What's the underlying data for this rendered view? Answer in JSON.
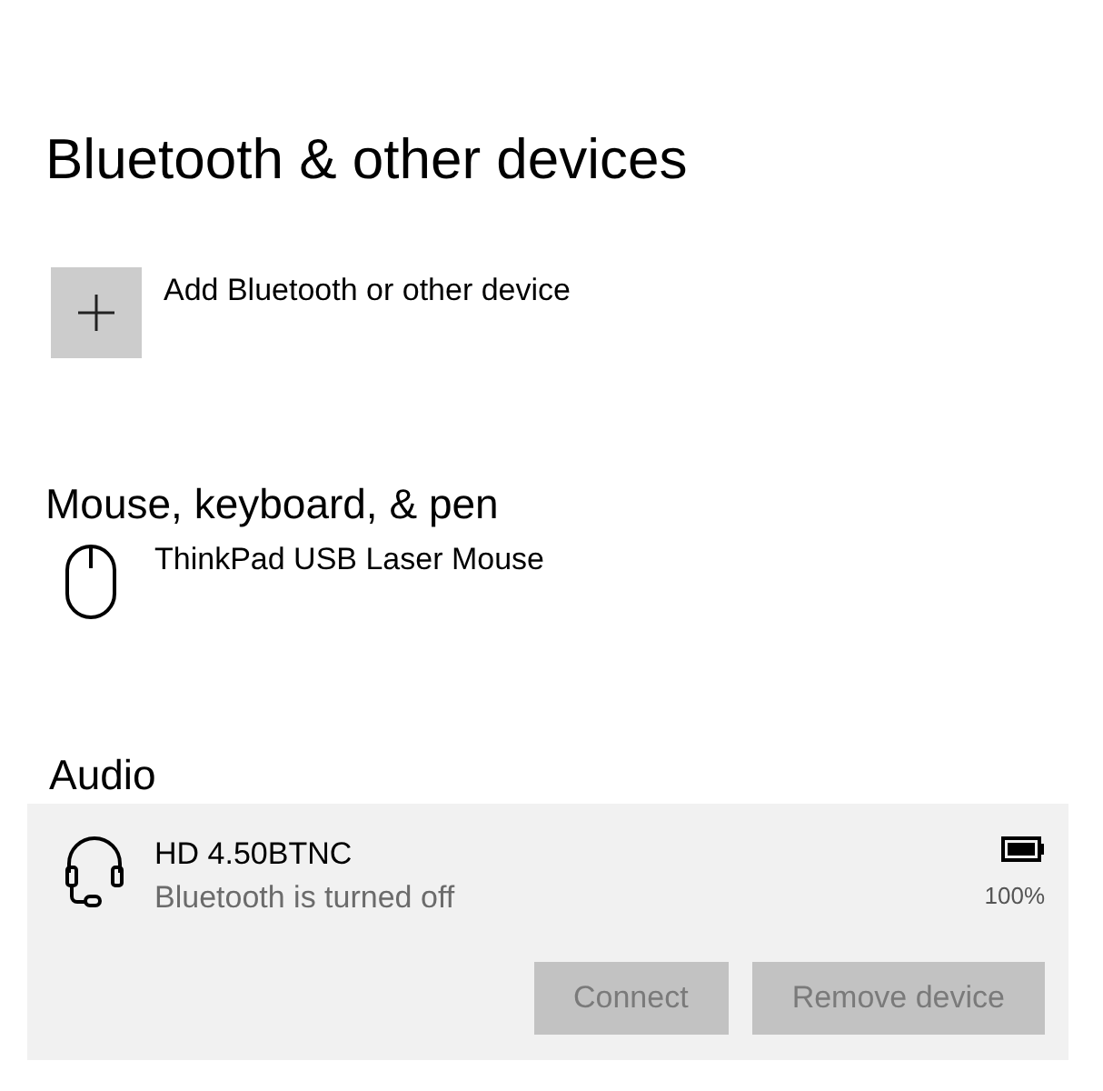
{
  "title": "Bluetooth & other devices",
  "add_device": {
    "label": "Add Bluetooth or other device"
  },
  "sections": [
    {
      "heading": "Mouse, keyboard, & pen",
      "devices": [
        {
          "kind": "mouse",
          "name": "ThinkPad USB Laser Mouse",
          "selected": false
        }
      ]
    },
    {
      "heading": "Audio",
      "devices": [
        {
          "kind": "headset",
          "name": "HD 4.50BTNC",
          "status": "Bluetooth is turned off",
          "battery": "100%",
          "selected": true,
          "buttons": [
            {
              "label": "Connect",
              "disabled": true
            },
            {
              "label": "Remove device",
              "disabled": true
            }
          ]
        }
      ]
    }
  ]
}
